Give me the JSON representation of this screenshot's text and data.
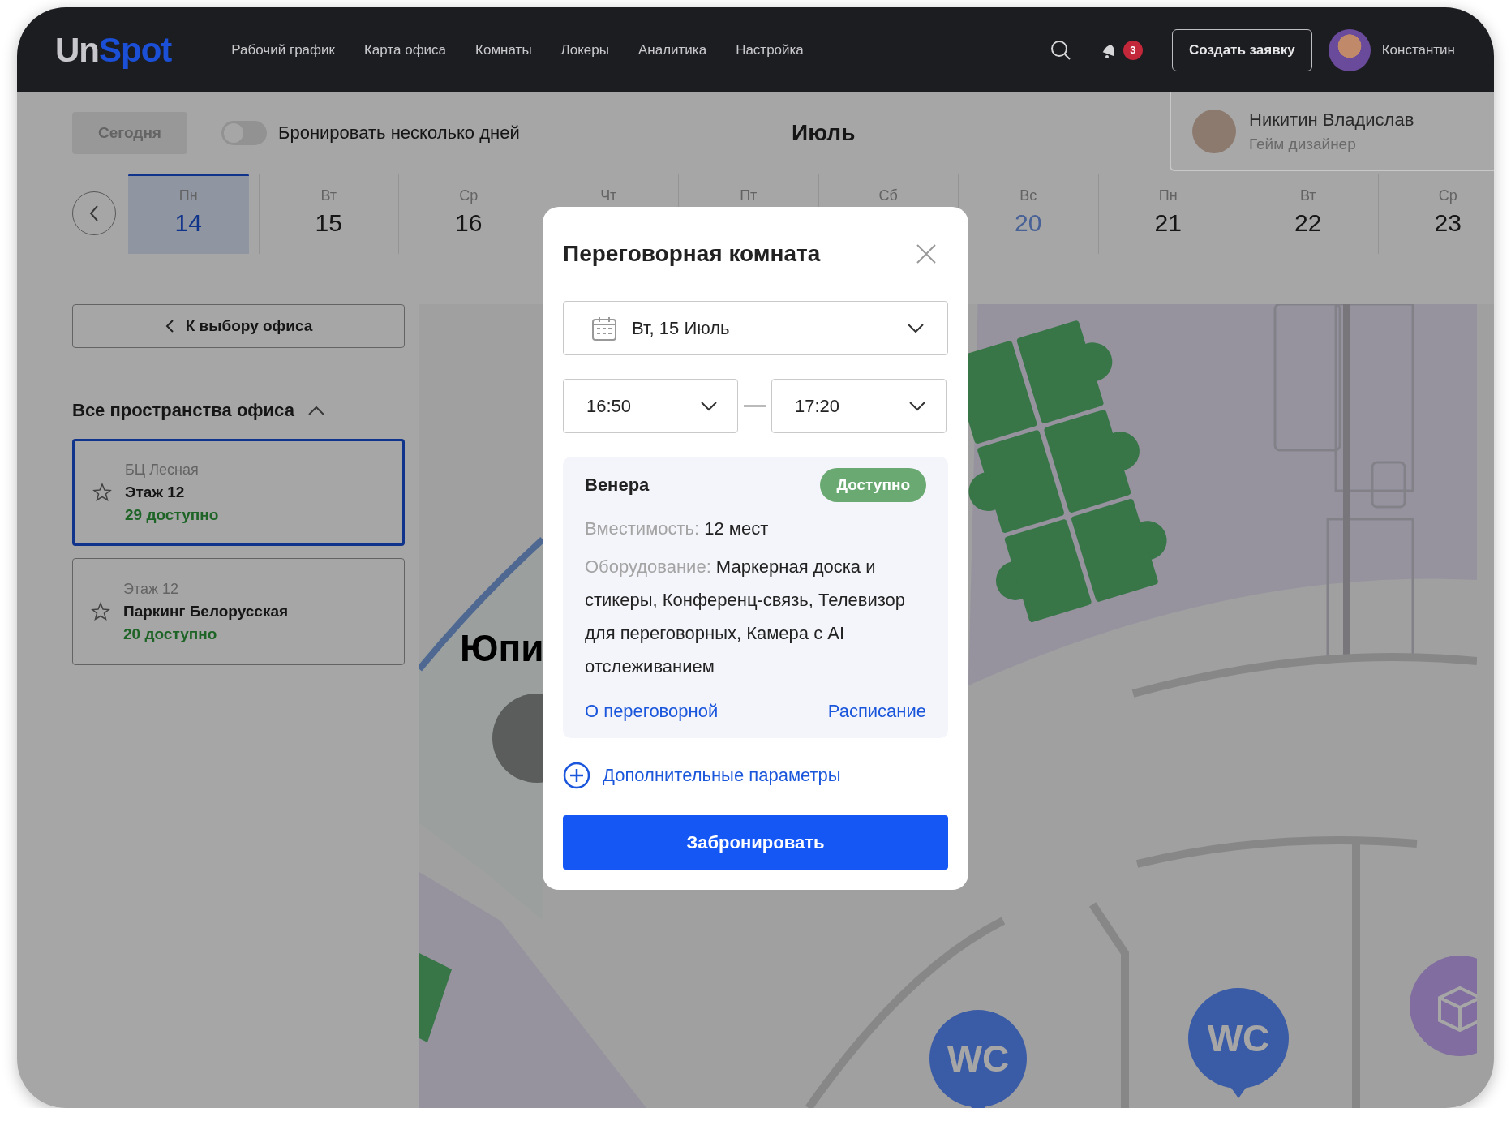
{
  "header": {
    "logo": {
      "part1": "Un",
      "part2": "Spot"
    },
    "nav": [
      {
        "label": "Рабочий график",
        "selected": false
      },
      {
        "label": "Карта офиса",
        "selected": false
      },
      {
        "label": "Комнаты",
        "selected": false
      },
      {
        "label": "Локеры",
        "selected": false
      },
      {
        "label": "Аналитика",
        "selected": false
      },
      {
        "label": "Настройка",
        "selected": false
      }
    ],
    "notifications_count": "3",
    "create_button": "Создать заявку",
    "user_name": "Константин"
  },
  "toolbar": {
    "today_button": {
      "label": "Сегодня",
      "disabled": true
    },
    "multi_day_toggle": {
      "label": "Бронировать несколько дней",
      "on": false
    },
    "month": "Июль"
  },
  "profile_popup": {
    "name": "Никитин Владислав",
    "role": "Гейм дизайнер"
  },
  "days": [
    {
      "weekday": "Пн",
      "number": "14",
      "selected": true,
      "weekend": false
    },
    {
      "weekday": "Вт",
      "number": "15",
      "selected": false,
      "weekend": false
    },
    {
      "weekday": "Ср",
      "number": "16",
      "selected": false,
      "weekend": false
    },
    {
      "weekday": "Чт",
      "selected": false
    },
    {
      "weekday": "Пт",
      "selected": false
    },
    {
      "weekday": "Сб",
      "selected": false
    },
    {
      "weekday": "Вс",
      "number": "20",
      "selected": false,
      "weekend": true
    },
    {
      "weekday": "Пн",
      "number": "21",
      "selected": false,
      "weekend": false
    },
    {
      "weekday": "Вт",
      "number": "22",
      "selected": false,
      "weekend": false
    },
    {
      "weekday": "Ср",
      "number": "23",
      "selected": false,
      "weekend": false
    }
  ],
  "sidebar": {
    "back_button": "К выбору офиса",
    "section_title": "Все пространства офиса",
    "expanded": true,
    "spaces": [
      {
        "subtitle": "БЦ Лесная",
        "title": "Этаж 12",
        "available": "29 доступно",
        "selected": true
      },
      {
        "subtitle": "Этаж 12",
        "title": "Паркинг Белорусская",
        "available": "20 доступно",
        "selected": false
      }
    ]
  },
  "map": {
    "room_label": "Юпи",
    "markers": [
      {
        "kind": "wc",
        "label": "WC"
      },
      {
        "kind": "wc",
        "label": "WC"
      },
      {
        "kind": "storage"
      }
    ]
  },
  "modal": {
    "title": "Переговорная комната",
    "date": "Вт, 15 Июль",
    "time_from": "16:50",
    "time_to": "17:20",
    "room": {
      "name": "Венера",
      "status": "Доступно",
      "capacity": {
        "label": "Вместимость:",
        "value": "12 мест"
      },
      "equipment": {
        "label": "Оборудование:",
        "value": "Маркерная доска и стикеры, Конференц-связь, Телевизор для переговорных, Камера с AI отслеживанием"
      },
      "links": [
        "О переговорной",
        "Расписание"
      ]
    },
    "extra_params": "Дополнительные параметры",
    "book_button": "Забронировать"
  }
}
